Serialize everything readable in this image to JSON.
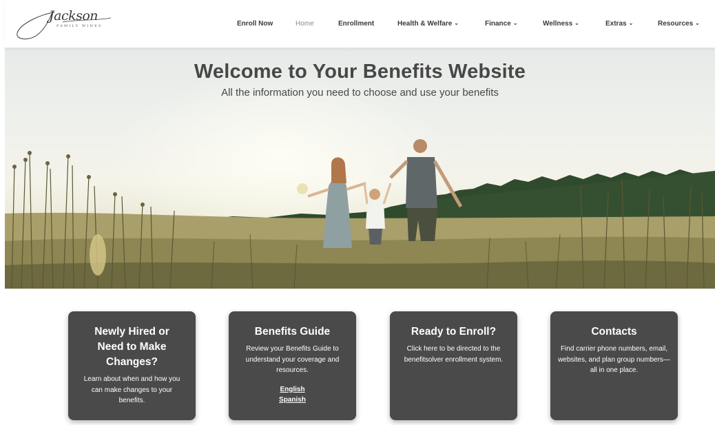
{
  "brand": {
    "logo_script": "Jackson",
    "logo_sub": "FAMILY WINES"
  },
  "nav": {
    "items": [
      {
        "label": "Enroll Now",
        "has_menu": false,
        "active": false
      },
      {
        "label": "Home",
        "has_menu": false,
        "active": true
      },
      {
        "label": "Enrollment",
        "has_menu": false,
        "active": false
      },
      {
        "label": "Health & Welfare",
        "has_menu": true,
        "active": false
      },
      {
        "label": "Finance",
        "has_menu": true,
        "active": false
      },
      {
        "label": "Wellness",
        "has_menu": true,
        "active": false
      },
      {
        "label": "Extras",
        "has_menu": true,
        "active": false
      },
      {
        "label": "Resources",
        "has_menu": true,
        "active": false
      }
    ],
    "chevron_icon": "chevron-down-icon"
  },
  "hero": {
    "title": "Welcome to Your Benefits Website",
    "subtitle": "All the information you need to choose and use your benefits"
  },
  "cards": [
    {
      "title": "Newly Hired or Need to Make Changes?",
      "text": "Learn about when and how you can make changes to your benefits."
    },
    {
      "title": "Benefits Guide",
      "text": "Review your Benefits Guide to understand your coverage and resources.",
      "links": [
        "English",
        "Spanish"
      ]
    },
    {
      "title": "Ready to Enroll?",
      "text": "Click here to be directed to the benefitsolver enrollment system."
    },
    {
      "title": "Contacts",
      "text": "Find carrier phone numbers, email, websites, and plan group numbers—all in one place."
    }
  ],
  "colors": {
    "card_bg": "#4b4a4a",
    "title_text": "#474747",
    "nav_text": "#3a3a3a",
    "nav_active": "#8a8a8a"
  }
}
